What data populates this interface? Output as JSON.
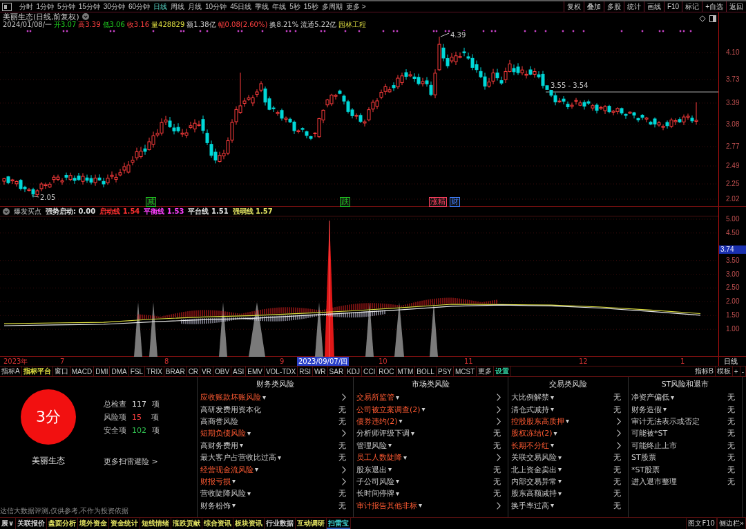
{
  "toolbar": {
    "periods": [
      {
        "label": "分时",
        "selected": false
      },
      {
        "label": "1分钟",
        "selected": false
      },
      {
        "label": "5分钟",
        "selected": false
      },
      {
        "label": "15分钟",
        "selected": false
      },
      {
        "label": "30分钟",
        "selected": false
      },
      {
        "label": "60分钟",
        "selected": false
      },
      {
        "label": "日线",
        "selected": true
      },
      {
        "label": "周线",
        "selected": false
      },
      {
        "label": "月线",
        "selected": false
      },
      {
        "label": "10分钟",
        "selected": false
      },
      {
        "label": "45日线",
        "selected": false
      },
      {
        "label": "季线",
        "selected": false
      },
      {
        "label": "年线",
        "selected": false
      },
      {
        "label": "5秒",
        "selected": false
      },
      {
        "label": "15秒",
        "selected": false
      },
      {
        "label": "多周期",
        "selected": false
      }
    ],
    "more": "更多 >",
    "buttons": [
      "复权",
      "叠加",
      "多股",
      "统计",
      "画线",
      "F10",
      "标记",
      "+自选",
      "返回"
    ]
  },
  "quote_header": {
    "title": "美丽生态(日线,前复权)",
    "date": "2024/01/08/一",
    "items": [
      {
        "label": "开",
        "value": "3.07",
        "color": "#20d020"
      },
      {
        "label": "高",
        "value": "3.39",
        "color": "#ff4040"
      },
      {
        "label": "低",
        "value": "3.06",
        "color": "#20d020"
      },
      {
        "label": "收",
        "value": "3.16",
        "color": "#ff4040"
      },
      {
        "label": "量",
        "value": "428829",
        "color": "#e0e040"
      },
      {
        "label": "额",
        "value": "1.38亿",
        "color": "#d0d0d0"
      },
      {
        "label": "幅",
        "value": "0.08(2.60%)",
        "color": "#ff4040"
      },
      {
        "label": "换",
        "value": "8.21%",
        "color": "#d0d0d0"
      },
      {
        "label": "流通",
        "value": "5.22亿",
        "color": "#d0d0d0"
      }
    ],
    "industry": "园林工程"
  },
  "price_chart": {
    "axis_labels": [
      "4.10",
      "3.73",
      "3.39",
      "3.08",
      "2.77",
      "2.49",
      "2.25",
      "2.02"
    ],
    "high_label": "4.39",
    "low_label": "2.05",
    "range_label": "3.55 - 3.54",
    "markers": [
      {
        "text": "减",
        "color": "#20c020"
      },
      {
        "text": "跌",
        "color": "#20c020"
      },
      {
        "text": "涨精",
        "color": "#ff4060"
      },
      {
        "text": "财",
        "color": "#4080ff"
      }
    ]
  },
  "indicator": {
    "name": "爆发买点",
    "values": [
      {
        "label": "强势启动:",
        "value": "0.00",
        "color": "#e0e0e0"
      },
      {
        "label": "启动线",
        "value": "1.54",
        "color": "#ff3030"
      },
      {
        "label": "平衡线",
        "value": "1.53",
        "color": "#ff40ff"
      },
      {
        "label": "平台线",
        "value": "1.51",
        "color": "#e0e0e0"
      },
      {
        "label": "强弱线",
        "value": "1.57",
        "color": "#e0e060"
      }
    ],
    "current_label": "3.74",
    "chart_data": {
      "type": "line",
      "categories": [
        null,
        null,
        null,
        null,
        null,
        null,
        null,
        null,
        null,
        null,
        null,
        null,
        null,
        null,
        null
      ],
      "series": [
        {
          "color": "#e0e040",
          "values": [
            1.2,
            1.23,
            1.25,
            1.37,
            1.45,
            1.5,
            1.58,
            1.67,
            1.79,
            1.91,
            1.9,
            1.88,
            1.81,
            1.7,
            1.57
          ]
        },
        {
          "color": "#e8e8e8",
          "values": [
            1.13,
            1.16,
            1.18,
            1.27,
            1.35,
            1.4,
            1.5,
            1.6,
            1.71,
            1.84,
            1.88,
            1.85,
            1.77,
            1.65,
            1.51
          ]
        }
      ],
      "ylim": [
        0,
        5.1
      ],
      "yticks": [
        {
          "value": 5,
          "label": "5.00"
        },
        {
          "value": 4.5,
          "label": "4.50"
        },
        {
          "value": 3.5,
          "label": "3.50"
        },
        {
          "value": 3,
          "label": "3.00"
        },
        {
          "value": 2.5,
          "label": "2.50"
        },
        {
          "value": 2,
          "label": "2.00"
        },
        {
          "value": 1.5,
          "label": "1.50"
        },
        {
          "value": 1,
          "label": "1.00"
        }
      ],
      "grid": true
    }
  },
  "date_axis": {
    "labels": [
      "2023年",
      "7",
      "8",
      "9",
      "10",
      "11",
      "12",
      "1"
    ],
    "cursor": "2023/09/07/四",
    "period": "日线"
  },
  "indicator_tabs": {
    "items": [
      {
        "label": "指标A"
      },
      {
        "label": "指标平台",
        "color": "#e0e040"
      },
      {
        "label": "窗口"
      },
      {
        "label": "MACD"
      },
      {
        "label": "DMI"
      },
      {
        "label": "DMA"
      },
      {
        "label": "FSL"
      },
      {
        "label": "TRIX"
      },
      {
        "label": "BRAR"
      },
      {
        "label": "CR"
      },
      {
        "label": "VR"
      },
      {
        "label": "OBV"
      },
      {
        "label": "ASI"
      },
      {
        "label": "EMV"
      },
      {
        "label": "VOL-TDX"
      },
      {
        "label": "RSI"
      },
      {
        "label": "WR"
      },
      {
        "label": "SAR"
      },
      {
        "label": "KDJ"
      },
      {
        "label": "CCI"
      },
      {
        "label": "ROC"
      },
      {
        "label": "MTM"
      },
      {
        "label": "BOLL"
      },
      {
        "label": "PSY"
      },
      {
        "label": "MCST"
      },
      {
        "label": "更多"
      },
      {
        "label": "设置",
        "color": "#30d0a0"
      }
    ],
    "right": [
      "指标B",
      "模板",
      "+",
      "-"
    ]
  },
  "risk_summary": {
    "score": "3分",
    "stock": "美丽生态",
    "stats": [
      {
        "label": "总检查",
        "value": "117",
        "unit": "项",
        "color": "#e0e0e0"
      },
      {
        "label": "风险项",
        "value": "15",
        "unit": "项",
        "color": "#ff4040"
      },
      {
        "label": "安全项",
        "value": "102",
        "unit": "项",
        "color": "#30c050"
      }
    ],
    "more_link": "更多扫雷避险 >",
    "disclaimer": "达信大数据评测,仅供参考,不作为投资依据"
  },
  "risk_columns": [
    {
      "title": "财务类风险",
      "items": [
        {
          "label": "应收账款坏账风险",
          "caret": "▾",
          "flagged": true
        },
        {
          "label": "高研发费用资本化",
          "flagged": false,
          "value": "无"
        },
        {
          "label": "高商誉风险",
          "flagged": false,
          "value": "无"
        },
        {
          "label": "短期负债风险",
          "caret": "▾",
          "flagged": true
        },
        {
          "label": "高财务费用",
          "caret": "▾",
          "flagged": false,
          "value": "无"
        },
        {
          "label": "最大客户占营收比过高",
          "caret": "▾",
          "flagged": false,
          "value": "无"
        },
        {
          "label": "经营现金流风险",
          "caret": "▾",
          "flagged": true
        },
        {
          "label": "财报亏损",
          "caret": "▾",
          "flagged": true
        },
        {
          "label": "营收陡降风险",
          "caret": "▾",
          "flagged": false,
          "value": "无"
        },
        {
          "label": "财务粉饰",
          "caret": "▾",
          "flagged": false,
          "value": "无"
        }
      ]
    },
    {
      "title": "市场类风险",
      "items": [
        {
          "label": "交易所监管",
          "caret": "▾",
          "flagged": true
        },
        {
          "label": "公司被立案调查(2)",
          "caret": "▾",
          "flagged": true
        },
        {
          "label": "债券违约(2)",
          "caret": "▾",
          "flagged": true
        },
        {
          "label": "分析师评级下调",
          "caret": "▾",
          "flagged": false,
          "value": "无"
        },
        {
          "label": "管理风险",
          "caret": "▾",
          "flagged": false,
          "value": "无"
        },
        {
          "label": "员工人数陡降",
          "caret": "▾",
          "flagged": true
        },
        {
          "label": "股东退出",
          "caret": "▾",
          "flagged": false,
          "value": "无"
        },
        {
          "label": "子公司风险",
          "caret": "▾",
          "flagged": false,
          "value": "无"
        },
        {
          "label": "长时间停牌",
          "caret": "▾",
          "flagged": false,
          "value": "无"
        },
        {
          "label": "审计报告其他非标",
          "caret": "▾",
          "flagged": true
        }
      ]
    },
    {
      "title": "交易类风险",
      "items": [
        {
          "label": "大比例解禁",
          "caret": "▾",
          "flagged": false,
          "value": "无"
        },
        {
          "label": "清仓式减持",
          "caret": "▾",
          "flagged": false,
          "value": "无"
        },
        {
          "label": "控股股东高质押",
          "caret": "▾",
          "flagged": true
        },
        {
          "label": "股权冻结(2)",
          "caret": "▾",
          "flagged": true
        },
        {
          "label": "长期不分红",
          "caret": "▾",
          "flagged": true
        },
        {
          "label": "关联交易风险",
          "caret": "▾",
          "flagged": false,
          "value": "无"
        },
        {
          "label": "北上资金卖出",
          "caret": "▾",
          "flagged": false,
          "value": "无"
        },
        {
          "label": "内部交易异常",
          "caret": "▾",
          "flagged": false,
          "value": "无"
        },
        {
          "label": "股东高额减持",
          "caret": "▾",
          "flagged": false,
          "value": "无"
        },
        {
          "label": "换手率过高",
          "caret": "▾",
          "flagged": false,
          "value": "无"
        }
      ]
    },
    {
      "title": "ST风险和退市",
      "items": [
        {
          "label": "净资产偏低",
          "caret": "▾",
          "flagged": false,
          "value": "无"
        },
        {
          "label": "财务造假",
          "caret": "▾",
          "flagged": false,
          "value": "无"
        },
        {
          "label": "审计无法表示或否定",
          "flagged": false,
          "value": "无"
        },
        {
          "label": "可能被*ST",
          "flagged": false,
          "value": "无"
        },
        {
          "label": "可能终止上市",
          "flagged": false,
          "value": "无"
        },
        {
          "label": "ST股票",
          "flagged": false,
          "value": "无"
        },
        {
          "label": "*ST股票",
          "flagged": false,
          "value": "无"
        },
        {
          "label": "进入退市整理",
          "flagged": false,
          "value": "无"
        }
      ]
    }
  ],
  "bottom_tabs": {
    "items": [
      {
        "label": "展∨",
        "color": "#d0d0d0",
        "selected": false
      },
      {
        "label": "关联报价",
        "color": "#d0d0d0",
        "selected": false
      },
      {
        "label": "盘面分析",
        "color": "#e0e060",
        "selected": false
      },
      {
        "label": "境外资金",
        "color": "#e0e060",
        "selected": false
      },
      {
        "label": "资金统计",
        "color": "#e0e060",
        "selected": false
      },
      {
        "label": "短线情绪",
        "color": "#e0e060",
        "selected": false
      },
      {
        "label": "涨跌贡献",
        "color": "#e0e060",
        "selected": false
      },
      {
        "label": "综合资讯",
        "color": "#e0e060",
        "selected": false
      },
      {
        "label": "板块资讯",
        "color": "#e0e060",
        "selected": false
      },
      {
        "label": "行业数据",
        "color": "#d0d0d0",
        "selected": false
      },
      {
        "label": "互动调研",
        "color": "#e0e060",
        "selected": false
      },
      {
        "label": "扫雷宝",
        "color": "#40e0e0",
        "selected": true
      }
    ],
    "right": [
      "图文F10",
      "侧边栏»"
    ]
  }
}
